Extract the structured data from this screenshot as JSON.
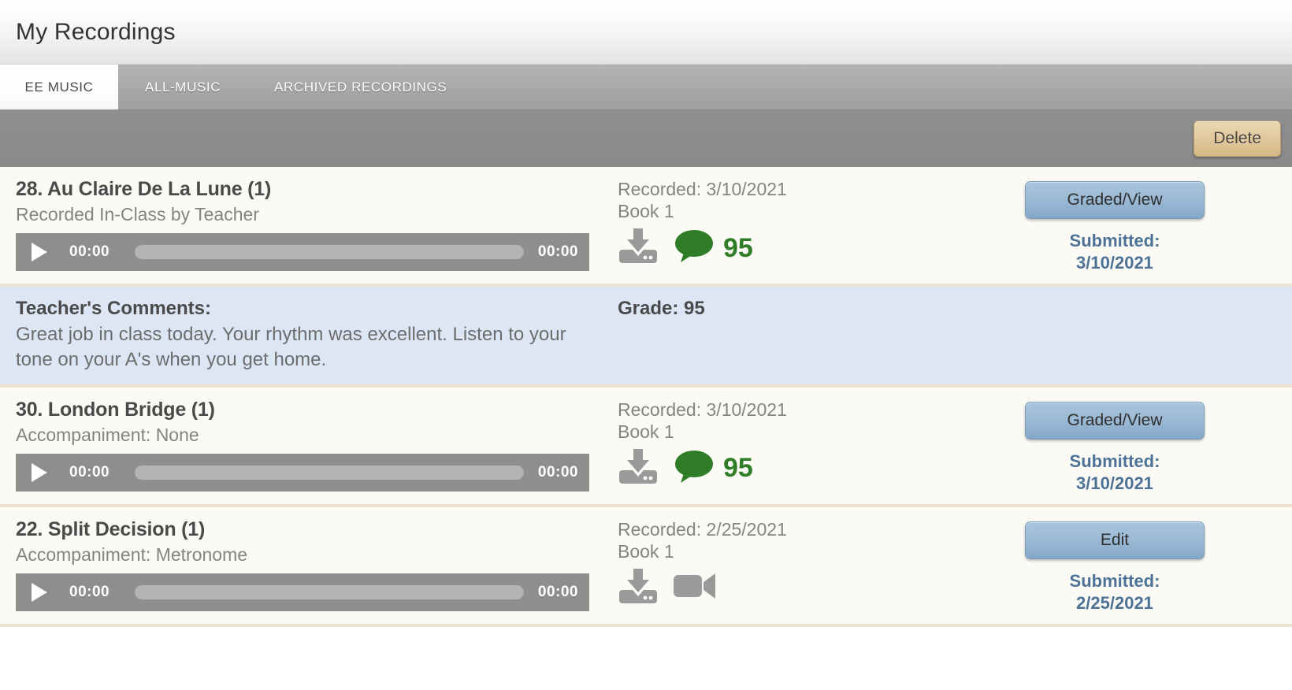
{
  "header": {
    "title": "My Recordings"
  },
  "tabs": [
    {
      "label": "EE MUSIC",
      "active": true
    },
    {
      "label": "ALL-MUSIC",
      "active": false
    },
    {
      "label": "ARCHIVED RECORDINGS",
      "active": false
    }
  ],
  "toolbar": {
    "delete_label": "Delete"
  },
  "colors": {
    "grade_green": "#2f7d26",
    "submitted_blue": "#4d7296",
    "delete_button": "#e2caa0",
    "action_button": "#9dbbd6",
    "comments_panel": "#dce6f5",
    "row_background": "#fbfaf5",
    "row_separator": "#ece2cf",
    "player_background": "#8e8e8e"
  },
  "recordings": [
    {
      "title": "28. Au Claire De La Lune (1)",
      "subtitle": "Recorded In-Class by Teacher",
      "player": {
        "play_icon": "play-icon",
        "current_time": "00:00",
        "duration": "00:00"
      },
      "recorded_label": "Recorded: 3/10/2021",
      "book_label": "Book 1",
      "icons": [
        "download-icon",
        "comment-bubble-icon"
      ],
      "grade": "95",
      "action_label": "Graded/View",
      "submitted_label": "Submitted:",
      "submitted_date": "3/10/2021"
    },
    {
      "title": "30. London Bridge (1)",
      "subtitle": "Accompaniment: None",
      "player": {
        "play_icon": "play-icon",
        "current_time": "00:00",
        "duration": "00:00"
      },
      "recorded_label": "Recorded: 3/10/2021",
      "book_label": "Book 1",
      "icons": [
        "download-icon",
        "comment-bubble-icon"
      ],
      "grade": "95",
      "action_label": "Graded/View",
      "submitted_label": "Submitted:",
      "submitted_date": "3/10/2021"
    },
    {
      "title": "22. Split Decision (1)",
      "subtitle": "Accompaniment: Metronome",
      "player": {
        "play_icon": "play-icon",
        "current_time": "00:00",
        "duration": "00:00"
      },
      "recorded_label": "Recorded: 2/25/2021",
      "book_label": "Book 1",
      "icons": [
        "download-icon",
        "video-camera-icon"
      ],
      "grade": null,
      "action_label": "Edit",
      "submitted_label": "Submitted:",
      "submitted_date": "2/25/2021"
    }
  ],
  "comments": {
    "label": "Teacher's Comments:",
    "body": "Great job in class today. Your rhythm was excellent. Listen to your tone on your A's when you get home.",
    "grade_label": "Grade: 95"
  }
}
